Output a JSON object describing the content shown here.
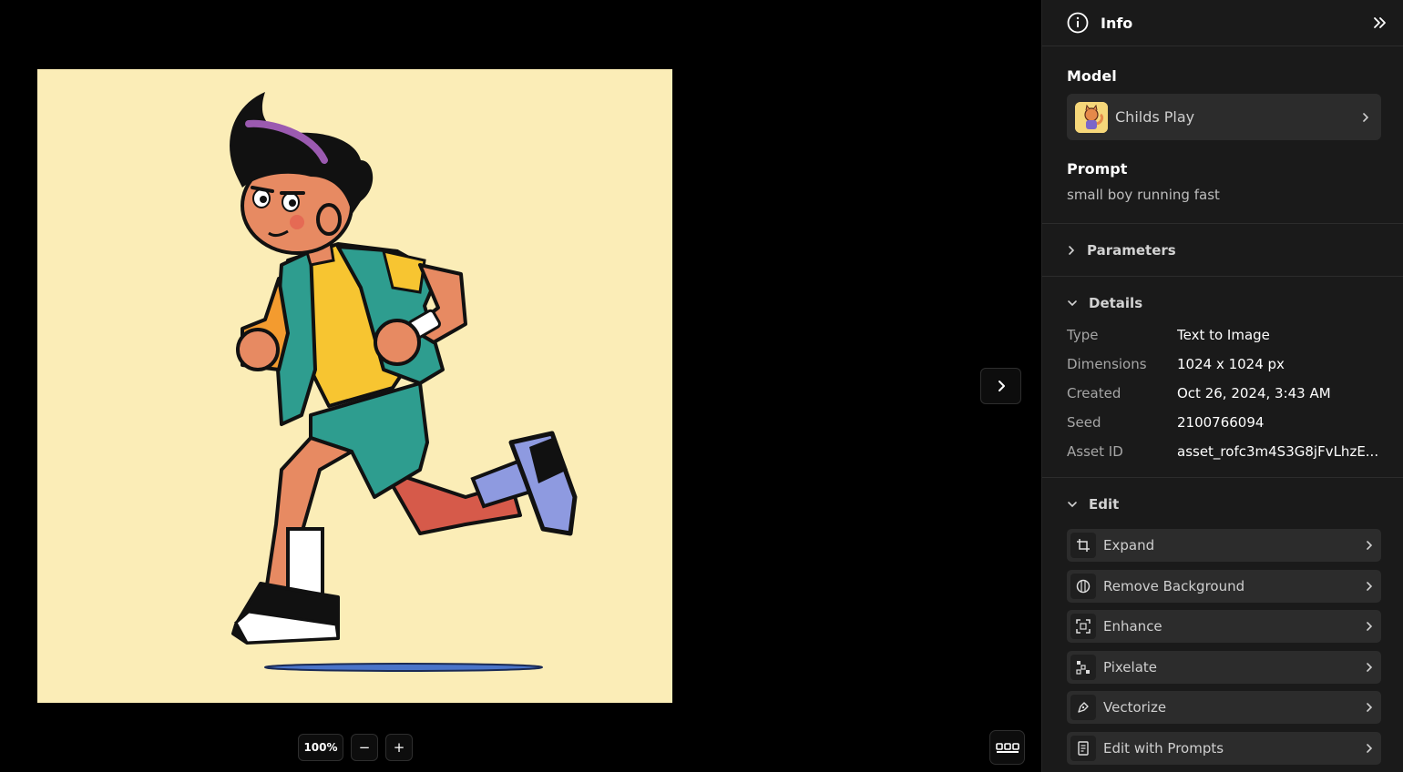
{
  "canvas": {
    "zoom": "100%",
    "zoom_out_label": "−",
    "zoom_in_label": "+"
  },
  "panel": {
    "title": "Info",
    "model": {
      "label": "Model",
      "name": "Childs Play"
    },
    "prompt": {
      "label": "Prompt",
      "text": "small boy running fast"
    },
    "parameters": {
      "label": "Parameters"
    },
    "details": {
      "label": "Details",
      "rows": [
        {
          "key": "Type",
          "value": "Text to Image"
        },
        {
          "key": "Dimensions",
          "value": "1024 x 1024 px"
        },
        {
          "key": "Created",
          "value": "Oct 26, 2024, 3:43 AM"
        },
        {
          "key": "Seed",
          "value": "2100766094"
        },
        {
          "key": "Asset ID",
          "value": "asset_rofc3m4S3G8jFvLhzE..."
        }
      ]
    },
    "edit": {
      "label": "Edit",
      "items": [
        {
          "label": "Expand",
          "icon": "crop-icon"
        },
        {
          "label": "Remove Background",
          "icon": "remove-background-icon"
        },
        {
          "label": "Enhance",
          "icon": "enhance-icon"
        },
        {
          "label": "Pixelate",
          "icon": "pixelate-icon"
        },
        {
          "label": "Vectorize",
          "icon": "pen-icon"
        },
        {
          "label": "Edit with Prompts",
          "icon": "document-icon"
        }
      ]
    }
  },
  "colors": {
    "image_background": "#fbedb7",
    "panel_background": "#1a1a1a",
    "card_background": "#2c2c2c"
  }
}
